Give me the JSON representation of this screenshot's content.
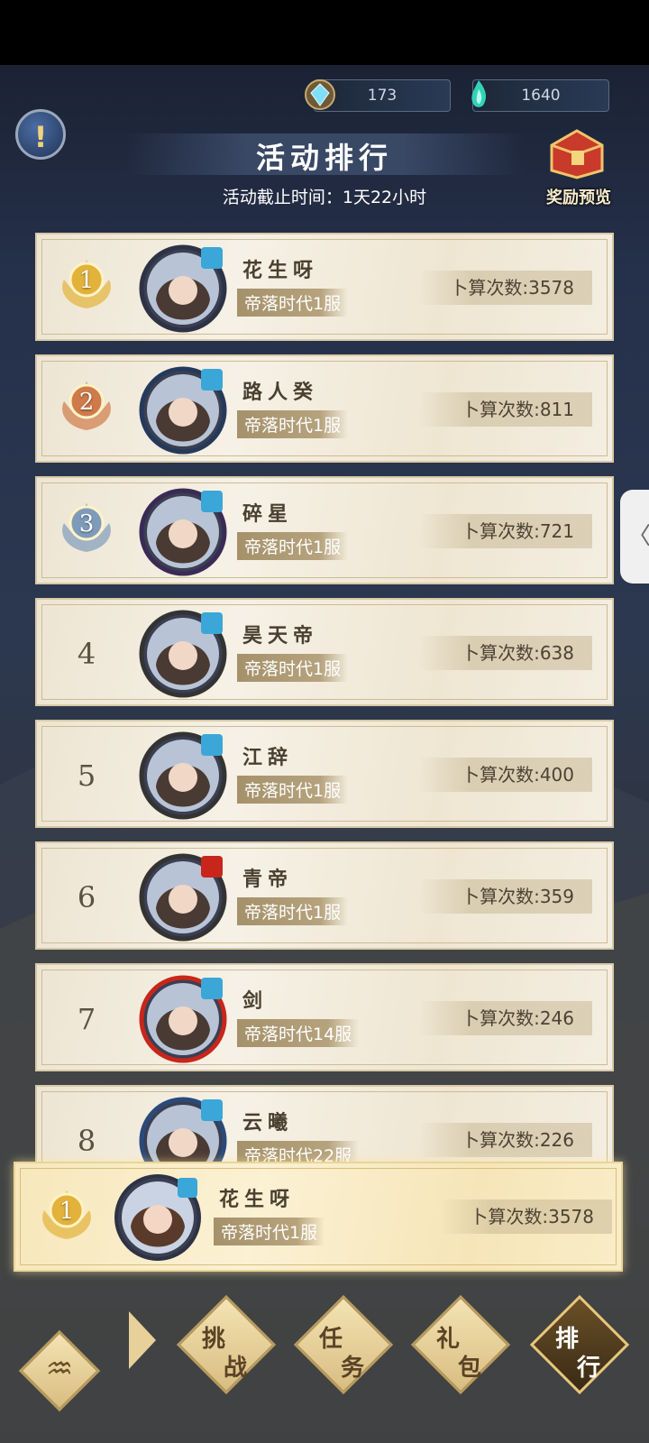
{
  "currency": {
    "gem": "173",
    "jade": "1640"
  },
  "header": {
    "title": "活动排行",
    "deadline": "活动截止时间：1天22小时",
    "reward_label": "奖励预览"
  },
  "colors": {
    "gold": "#e2b23a",
    "silver": "#7f9bbb",
    "bronze": "#cf7a4a"
  },
  "rankings": [
    {
      "rank": "1",
      "name": "花生呀",
      "server": "帝落时代1服",
      "score": "卜算次数:3578",
      "badge": "仙"
    },
    {
      "rank": "2",
      "name": "路人癸",
      "server": "帝落时代1服",
      "score": "卜算次数:811",
      "badge": "仙"
    },
    {
      "rank": "3",
      "name": "碎星",
      "server": "帝落时代1服",
      "score": "卜算次数:721",
      "badge": "仙"
    },
    {
      "rank": "4",
      "name": "昊天帝",
      "server": "帝落时代1服",
      "score": "卜算次数:638",
      "badge": "仙"
    },
    {
      "rank": "5",
      "name": "江辞",
      "server": "帝落时代1服",
      "score": "卜算次数:400",
      "badge": "仙"
    },
    {
      "rank": "6",
      "name": "青帝",
      "server": "帝落时代1服",
      "score": "卜算次数:359",
      "badge": "魔"
    },
    {
      "rank": "7",
      "name": "剑",
      "server": "帝落时代14服",
      "score": "卜算次数:246",
      "badge": "仙"
    },
    {
      "rank": "8",
      "name": "云曦",
      "server": "帝落时代22服",
      "score": "卜算次数:226",
      "badge": "仙"
    }
  ],
  "me": {
    "rank": "1",
    "name": "花生呀",
    "server": "帝落时代1服",
    "score": "卜算次数:3578",
    "badge": "仙"
  },
  "nav": [
    {
      "a": "挑",
      "b": "战"
    },
    {
      "a": "任",
      "b": "务"
    },
    {
      "a": "礼",
      "b": "包"
    },
    {
      "a": "排",
      "b": "行"
    }
  ],
  "side_tab": "〈"
}
